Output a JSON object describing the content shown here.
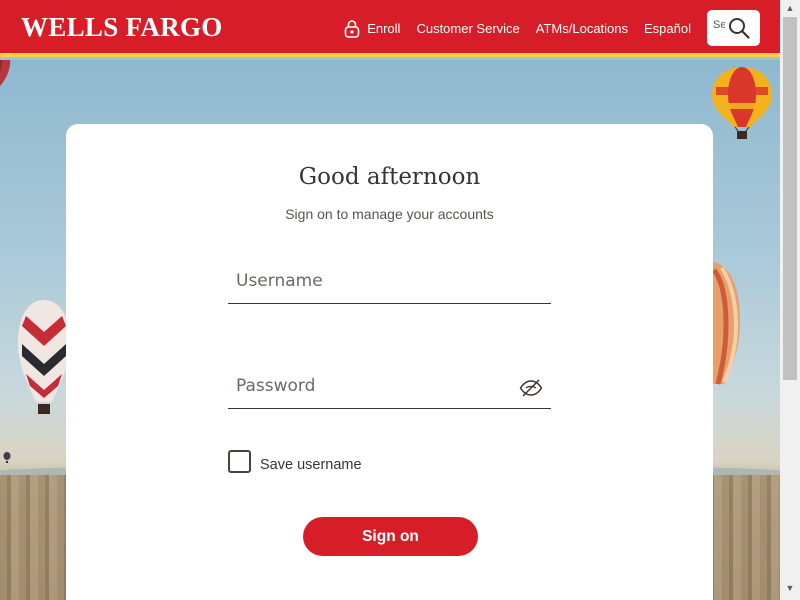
{
  "header": {
    "logo": "WELLS FARGO",
    "nav": [
      {
        "label": "Enroll",
        "icon": "lock-icon"
      },
      {
        "label": "Customer Service"
      },
      {
        "label": "ATMs/Locations"
      },
      {
        "label": "Español"
      }
    ],
    "search": {
      "value": "Se",
      "icon": "search-icon"
    }
  },
  "login": {
    "greeting": "Good afternoon",
    "subtitle": "Sign on to manage your accounts",
    "username_placeholder": "Username",
    "password_placeholder": "Password",
    "password_toggle_icon": "eye-slash-icon",
    "save_username_label": "Save username",
    "save_username_checked": false,
    "signon_label": "Sign on"
  },
  "colors": {
    "brand_red": "#d71e28",
    "brand_yellow": "#ffcd41",
    "card_bg": "#ffffff",
    "text_dark": "#3b3331"
  }
}
